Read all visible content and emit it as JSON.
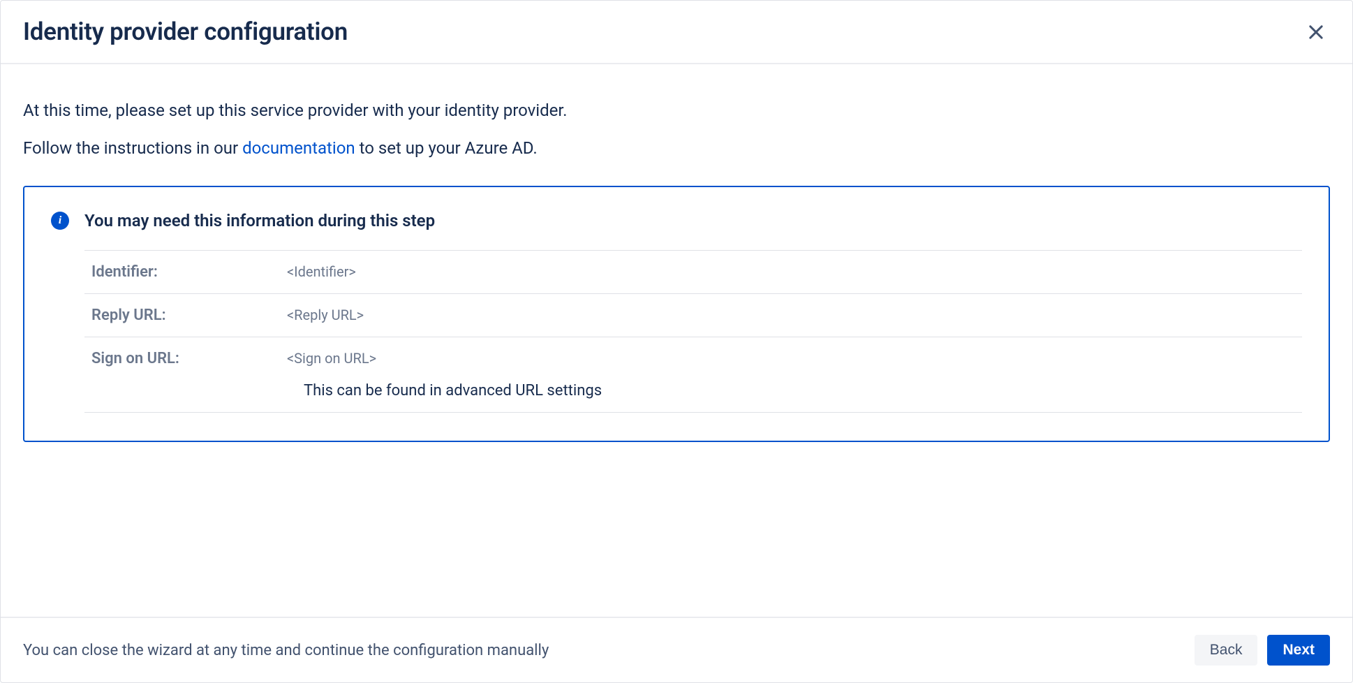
{
  "header": {
    "title": "Identity provider configuration"
  },
  "content": {
    "intro_line1": "At this time, please set up this service provider with your identity provider.",
    "intro_line2_a": "Follow the instructions in our ",
    "intro_link": "documentation",
    "intro_line2_b": " to set up your Azure AD."
  },
  "info": {
    "title": "You may need this information during this step",
    "rows": [
      {
        "label": "Identifier:",
        "value": "<Identifier>"
      },
      {
        "label": "Reply URL:",
        "value": "<Reply URL>"
      },
      {
        "label": "Sign on URL:",
        "value": "<Sign on URL>",
        "note": "This can be found in advanced URL settings"
      }
    ]
  },
  "footer": {
    "text": "You can close the wizard at any time and continue the configuration manually",
    "back_label": "Back",
    "next_label": "Next"
  }
}
